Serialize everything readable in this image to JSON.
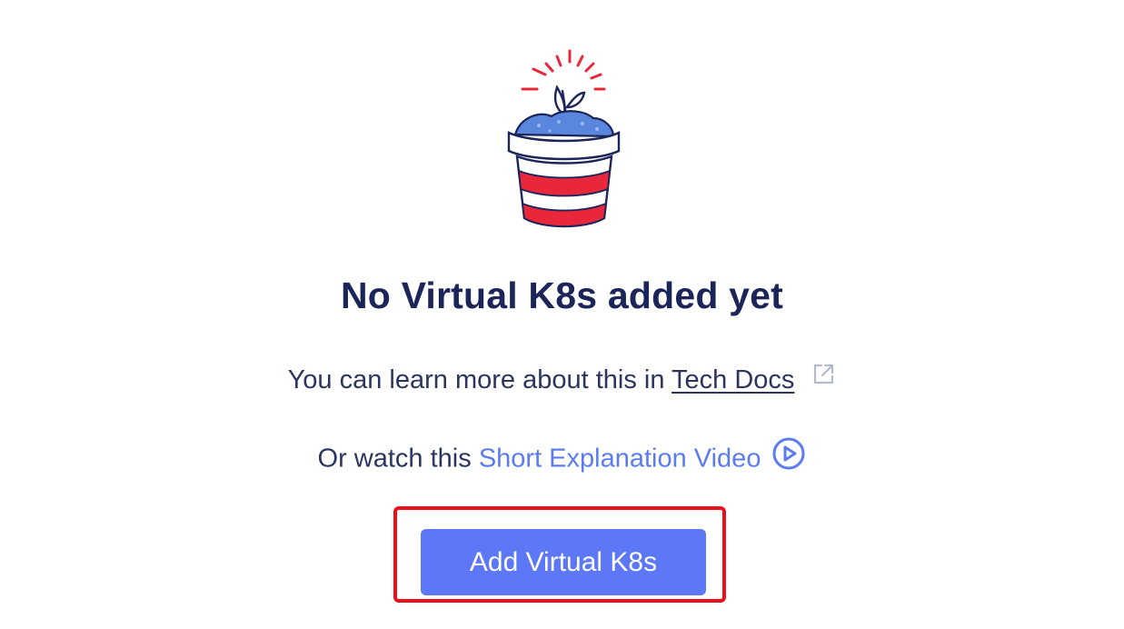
{
  "empty_state": {
    "title": "No Virtual K8s added yet",
    "learn_prefix": "You can learn more about this in ",
    "docs_link": "Tech Docs",
    "watch_prefix": "Or watch this ",
    "video_link": "Short Explanation Video",
    "illustration_icon": "flower-pot-sprout-icon",
    "external_link_icon": "external-link-icon",
    "play_icon": "play-circle-icon"
  },
  "actions": {
    "add_button_label": "Add Virtual K8s"
  },
  "colors": {
    "title": "#1b2559",
    "body_text": "#2c3560",
    "link_accent": "#5b7cf0",
    "primary_button": "#5c78f6",
    "highlight_box": "#ee0f1c",
    "pot_red": "#e8283a",
    "soil_blue": "#5b86dd"
  }
}
